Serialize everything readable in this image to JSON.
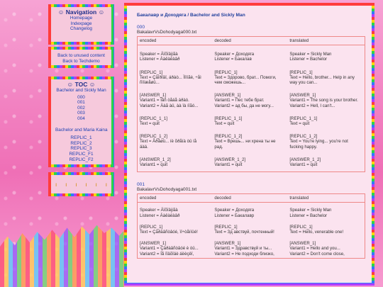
{
  "nav": {
    "title": "Navigation",
    "links": [
      "Homepage",
      "Indexpage",
      "Changelog"
    ]
  },
  "back": {
    "links": [
      "Back to unused content",
      "Back to Techdemo"
    ]
  },
  "toc": {
    "title": "TOC",
    "group1_title": "Bachelor and Sickly Man",
    "group1_items": [
      "000",
      "001",
      "002",
      "003",
      "004"
    ],
    "group2_title": "Bachelor and Maria Kaina",
    "group2_items": [
      "REPLIC_1",
      "REPLIC_2",
      "REPLIC_3",
      "REPLIC_F1",
      "REPLIC_F2"
    ]
  },
  "main": {
    "title": "Бакалавр и Доходяга / Bachelor and Sickly Man",
    "sections": [
      {
        "num": "000",
        "file": "BakalavrVsDohodyaga000.txt",
        "headers": [
          "encoded",
          "decoded",
          "translated"
        ],
        "rows": [
          [
            "Speaker = Äîõîäÿãà\nListener = Áàêàëàâð",
            "Speaker = Доходяга\nListener = Бакалав",
            "Speaker = Sickly Man\nListener = Bachelor"
          ],
          [
            "[REPLIC_1]\nText = Çäîðîâî, áðàò... Ïîìîãè, ÷åì\nñìîæåøü...",
            "[REPLIC_1]\nText = Здорово, брат... Помоги,\nчем сможешь...",
            "[REPLIC_1]\nText = Hello, brother... Help in any\nway you can..."
          ],
          [
            "[ANSWER_1]\nVariant1 = Ïåñ òåáå áðàò.\nVariant2 = Äàã àû, àà îà íîãó...",
            "[ANSWER_1]\nVariant1 = Пес тебе брат.\nVariant2 = ад бы, да не могу...",
            "[ANSWER_1]\nVariant1 = The song is your brother.\nVariant2 = Hell, I can't..."
          ],
          [
            "[REPLIC_1_1]\nText = quit",
            "[REPLIC_1_1]\nText = quit",
            "[REPLIC_1_1]\nText = quit"
          ],
          [
            "[REPLIC_1_2]\nText = Âðåøü... íè õðåíà òû íå\näàä.",
            "[REPLIC_1_2]\nText = Врешь... ни хрена ты не\nрад.",
            "[REPLIC_1_2]\nText = You're lying... you're not\nfucking happy."
          ],
          [
            "[ANSWER_1_2]\nVariant1 = quit",
            "[ANSWER_1_2]\nVariant1 = quit",
            "[ANSWER_1_2]\nVariant1 = quit"
          ]
        ]
      },
      {
        "num": "001",
        "file": "BakalavrVsDohodyaga001.txt",
        "headers": [
          "encoded",
          "decoded",
          "translated"
        ],
        "rows": [
          [
            "Speaker = Äîõîäÿãà\nListener = Áàêàëàâð",
            "Speaker = Доходяга\nListener = Бакалавр",
            "Speaker = Sickly Man\nListener = Bachelor"
          ],
          [
            "[REPLIC_1]\nText = Çäðàâñòâóé, ïî÷òåííûé!",
            "[REPLIC_1]\nText = Зд авствуй, почтенный!",
            "[REPLIC_1]\nText = Hello, venerable one!"
          ],
          [
            "[ANSWER_1]\nVariant1 = Çäðàâñòâóé è òû...\nVariant2 = Íå ïîäõîäè áëèçêî,",
            "[ANSWER_1]\nVariant1 = Здравствуй и ты...\nVariant2 = Не подходи близко,",
            "[ANSWER_1]\nVariant1 = Hello and you...\nVariant2 = Don't come close,"
          ]
        ]
      }
    ]
  }
}
